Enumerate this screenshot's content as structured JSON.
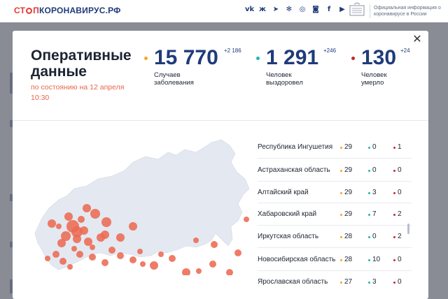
{
  "site": {
    "logo_part1": "СТ",
    "logo_part2": "П",
    "logo_part3": "КОРОНАВИРУС.РФ",
    "socials": [
      "vk-icon",
      "ok-icon",
      "telegram-icon",
      "tenchat-icon",
      "viber-icon",
      "instagram-icon",
      "facebook-icon",
      "youtube-icon"
    ],
    "official_text": "Официальная информация о коронавирусе в России"
  },
  "modal": {
    "title": "Оперативные данные",
    "as_of": "по состоянию на 12 апреля 10:30",
    "stats": [
      {
        "value": "15 770",
        "delta": "+2 186",
        "label": "Случаев заболевания",
        "dot_color": "#f5a623"
      },
      {
        "value": "1 291",
        "delta": "+246",
        "label": "Человек выздоровел",
        "dot_color": "#26b5a8"
      },
      {
        "value": "130",
        "delta": "+24",
        "label": "Человек умерло",
        "dot_color": "#c62828"
      }
    ],
    "regions": [
      {
        "name": "Республика Ингушетия",
        "cases": "29",
        "recovered": "0",
        "deaths": "1"
      },
      {
        "name": "Астраханская область",
        "cases": "29",
        "recovered": "0",
        "deaths": "0"
      },
      {
        "name": "Алтайский край",
        "cases": "29",
        "recovered": "3",
        "deaths": "0"
      },
      {
        "name": "Хабаровский край",
        "cases": "29",
        "recovered": "7",
        "deaths": "2"
      },
      {
        "name": "Иркутская область",
        "cases": "28",
        "recovered": "0",
        "deaths": "2"
      },
      {
        "name": "Новосибирская область",
        "cases": "28",
        "recovered": "10",
        "deaths": "0"
      },
      {
        "name": "Ярославская область",
        "cases": "27",
        "recovered": "3",
        "deaths": "0"
      }
    ]
  },
  "colors": {
    "brand_blue": "#1f3b7a",
    "accent_red": "#e53935",
    "bubble": "#ec6a52",
    "map_land": "#e4e8f1"
  }
}
